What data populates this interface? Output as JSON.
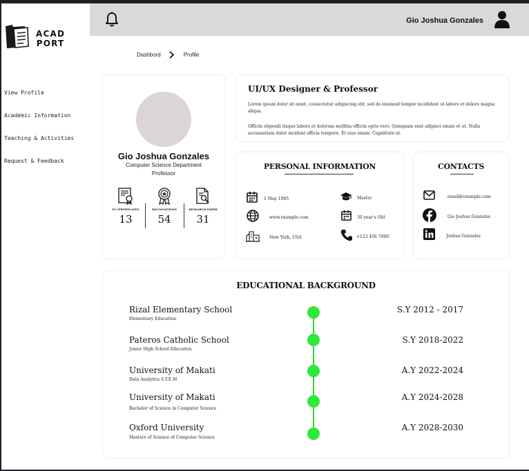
{
  "app": {
    "logo_line1": "ACAD",
    "logo_line2": "PORT"
  },
  "sidebar": {
    "items": [
      {
        "label": "View Profile"
      },
      {
        "label": "Academic Information"
      },
      {
        "label": "Teaching & Activities"
      },
      {
        "label": "Request & Feedback"
      }
    ]
  },
  "header": {
    "user_name": "Gio Joshua Gonzales",
    "icons": [
      "bell-icon",
      "user-icon"
    ]
  },
  "breadcrumb": {
    "items": [
      "Dashbord",
      "Profile"
    ]
  },
  "profile": {
    "name": "Gio Joshua Gonzales",
    "department": "Computer Science Department",
    "role": "Professor",
    "stats": [
      {
        "label": "IT CERTIFICATES",
        "value": "13",
        "icon": "certificate-icon"
      },
      {
        "label": "RECOGNITIONS",
        "value": "54",
        "icon": "award-icon"
      },
      {
        "label": "RESEARCH PAPER",
        "value": "31",
        "icon": "research-paper-icon"
      }
    ]
  },
  "about": {
    "title": "UI/UX Designer & Professor",
    "paragraph1": "Lorem ipsum dolor sit amet, consectetur adipiscing elit, sed do eiusmod tempor incididunt ut labore et dolore magna aliqua.",
    "paragraph2": "Officiis eligendi itaque labore et dolorum mollitia officiis optio vero. Quisquam sunt adipisci omnis et ut. Nulla accusantium dolor incidunt officia tempore. Et eius omnis. Cupiditate ut."
  },
  "personal_info": {
    "title": "PERSONAL INFORMATION",
    "birthdate": "1 May 1995",
    "education": "Master",
    "website": "www.example.com",
    "age": "30 year's Old",
    "address": "New York, USA",
    "phone": "+123 456 7890"
  },
  "contacts": {
    "title": "CONTACTS",
    "email": "email@example.com",
    "facebook": "Gio Joshua Gonzales",
    "linkedin": "Joshua Gonzales"
  },
  "education": {
    "title": "EDUCATIONAL BACKGROUND",
    "accent": "#2ee83a",
    "entries": [
      {
        "school": "Rizal Elementary School",
        "level": "Elementary Education",
        "years": "S.Y 2012 - 2017"
      },
      {
        "school": "Pateros Catholic School",
        "level": "Junior High School Educaiton",
        "years": "S.Y 2018-2022"
      },
      {
        "school": "University of Makati",
        "level": "Data Analytics S.T.E.M",
        "years": "A.Y 2022-2024"
      },
      {
        "school": "University of Makati",
        "level": "Bachelor of Science in Computer Science",
        "years": "A.Y 2024-2028"
      },
      {
        "school": "Oxford University",
        "level": "Masters of Science of Computer Science",
        "years": "A.Y 2028-2030"
      }
    ]
  }
}
